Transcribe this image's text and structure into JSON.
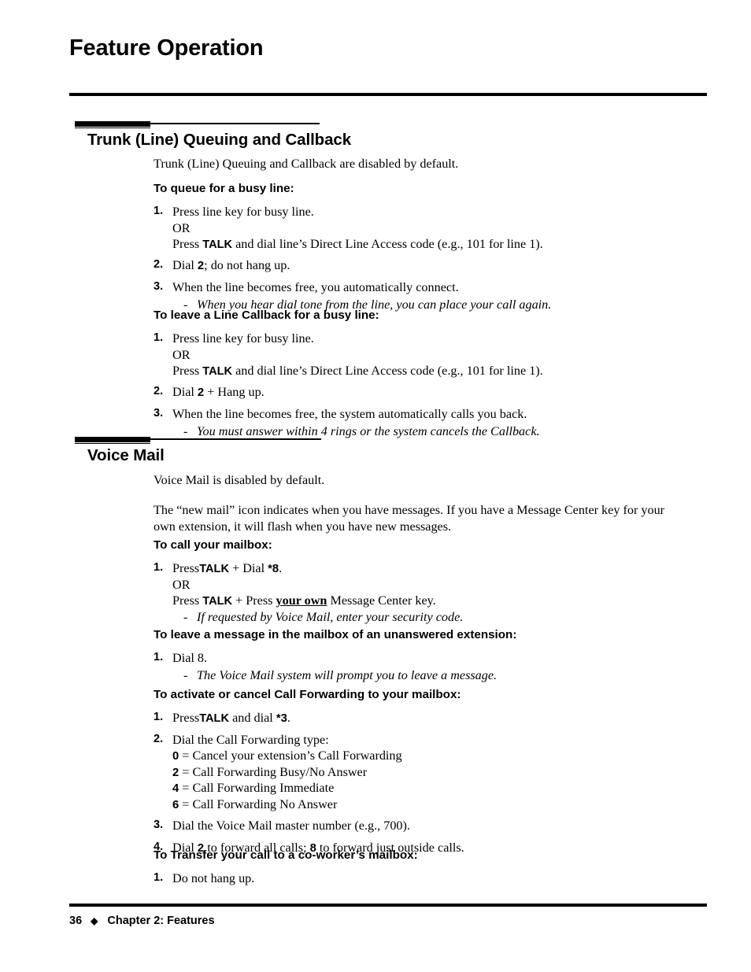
{
  "page": {
    "title": "Feature Operation"
  },
  "sections": [
    {
      "heading": "Trunk (Line) Queuing and Callback",
      "intro": "Trunk (Line) Queuing and Callback are disabled by default.",
      "procedures": [
        {
          "heading": "To queue for a busy line:",
          "steps": [
            {
              "num": "1.",
              "lines": [
                "Press line key for busy line.",
                "OR",
                "Press TALK and dial line’s Direct Line Access code (e.g., 101 for line 1)."
              ]
            },
            {
              "num": "2.",
              "lines": [
                "Dial 2; do not hang up."
              ]
            },
            {
              "num": "3.",
              "lines": [
                "When the line becomes free, you automatically connect."
              ]
            }
          ],
          "notes": [
            {
              "dash": "-",
              "text": "When you hear dial tone from the line, you can place your call again."
            }
          ]
        },
        {
          "heading": "To leave a Line Callback for a busy line:",
          "steps": [
            {
              "num": "1.",
              "lines": [
                "Press line key for busy line.",
                "OR",
                "Press TALK and dial line’s Direct Line Access code (e.g., 101 for line 1)."
              ]
            },
            {
              "num": "2.",
              "lines": [
                "Dial 2 + Hang up."
              ]
            },
            {
              "num": "3.",
              "lines": [
                "When the line becomes free, the system automatically calls you back."
              ]
            }
          ],
          "notes": [
            {
              "dash": "-",
              "text": "You must answer within 4 rings or the system cancels the Callback."
            }
          ]
        }
      ]
    },
    {
      "heading": "Voice Mail",
      "intro": "Voice Mail is disabled by default.",
      "intro2": "The “new mail” icon indicates when you have messages. If you have a Message Center key for your own extension, it will flash when you have new messages.",
      "procedures": [
        {
          "heading": "To call your mailbox:",
          "steps": [
            {
              "num": "1.",
              "lines": [
                "Press TALK + Dial *8.",
                "OR",
                "Press TALK + Press your own Message Center key."
              ]
            }
          ],
          "notes": [
            {
              "dash": "-",
              "text": "If requested by Voice Mail, enter your security code."
            }
          ]
        },
        {
          "heading": "To leave a message in the mailbox of an unanswered extension:",
          "steps": [
            {
              "num": "1.",
              "lines": [
                "Dial 8."
              ]
            }
          ],
          "notes": [
            {
              "dash": "-",
              "text": "The Voice Mail system will prompt you to leave a message."
            }
          ]
        },
        {
          "heading": "To activate or cancel Call Forwarding to your mailbox:",
          "steps": [
            {
              "num": "1.",
              "lines": [
                "Press TALK and dial *3."
              ]
            },
            {
              "num": "2.",
              "lines": [
                "Dial the Call Forwarding type:"
              ]
            },
            {
              "num": "3.",
              "lines": [
                "Dial the Voice Mail master number (e.g., 700)."
              ]
            },
            {
              "num": "4.",
              "lines": [
                "Dial 2 to forward all calls; 8 to forward just outside calls."
              ]
            }
          ],
          "options": [
            {
              "key": "0",
              "eq": "=",
              "label": "Cancel your extension’s Call Forwarding"
            },
            {
              "key": "2",
              "eq": "=",
              "label": "Call Forwarding Busy/No Answer"
            },
            {
              "key": "4",
              "eq": "=",
              "label": "Call Forwarding Immediate"
            },
            {
              "key": "6",
              "eq": "=",
              "label": "Call Forwarding No Answer"
            }
          ]
        },
        {
          "heading": "To Transfer your call to a co-worker’s mailbox:",
          "steps": [
            {
              "num": "1.",
              "lines": [
                "Do not hang up."
              ]
            }
          ]
        }
      ]
    }
  ],
  "labels": {
    "talk_key": "TALK",
    "or": "OR",
    "your_own": "your own"
  },
  "footer": {
    "page_number": "36",
    "diamond": "◆",
    "chapter": "Chapter 2: Features"
  }
}
